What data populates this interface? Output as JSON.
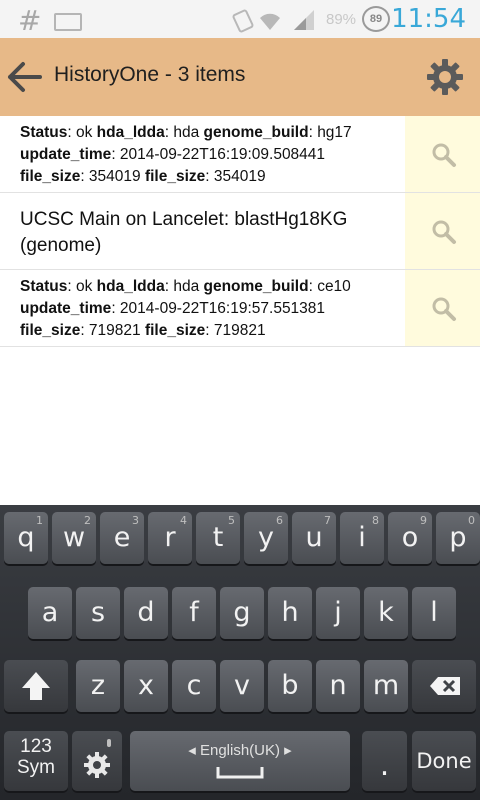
{
  "status_bar": {
    "left_glyph": "#",
    "battery": "89",
    "battery_pct": "89%",
    "time": "11:54"
  },
  "action_bar": {
    "title": "HistoryOne - 3 items"
  },
  "items": [
    {
      "kind": "meta",
      "status_label": "Status",
      "status_value": ": ok ",
      "lda_label": "hda_ldda",
      "lda_value": ": hda ",
      "genome_label": "genome_build",
      "genome_value": ": hg17",
      "update_label": "update_time",
      "update_value": ": 2014-09-22T16:19:09.508441",
      "size_label": "file_size",
      "size_value": ": 354019 ",
      "size2_label": "file_size",
      "size2_value": ": 354019"
    },
    {
      "kind": "title",
      "text": "UCSC Main on Lancelet: blastHg18KG (genome)"
    },
    {
      "kind": "meta",
      "status_label": "Status",
      "status_value": ": ok ",
      "lda_label": "hda_ldda",
      "lda_value": ": hda ",
      "genome_label": "genome_build",
      "genome_value": ": ce10",
      "update_label": "update_time",
      "update_value": ": 2014-09-22T16:19:57.551381",
      "size_label": "file_size",
      "size_value": ": 719821 ",
      "size2_label": "file_size",
      "size2_value": ": 719821"
    }
  ],
  "keyboard": {
    "row1": [
      {
        "ch": "q",
        "num": "1"
      },
      {
        "ch": "w",
        "num": "2"
      },
      {
        "ch": "e",
        "num": "3"
      },
      {
        "ch": "r",
        "num": "4"
      },
      {
        "ch": "t",
        "num": "5"
      },
      {
        "ch": "y",
        "num": "6"
      },
      {
        "ch": "u",
        "num": "7"
      },
      {
        "ch": "i",
        "num": "8"
      },
      {
        "ch": "o",
        "num": "9"
      },
      {
        "ch": "p",
        "num": "0"
      }
    ],
    "row2": [
      "a",
      "s",
      "d",
      "f",
      "g",
      "h",
      "j",
      "k",
      "l"
    ],
    "row3": [
      "z",
      "x",
      "c",
      "v",
      "b",
      "n",
      "m"
    ],
    "sym_line1": "123",
    "sym_line2": "Sym",
    "space_label": "English(UK)",
    "period": ".",
    "done": "Done"
  },
  "colors": {
    "action_bar": "#e7b988",
    "item_side": "#fffbdd",
    "time": "#39a8d8"
  }
}
